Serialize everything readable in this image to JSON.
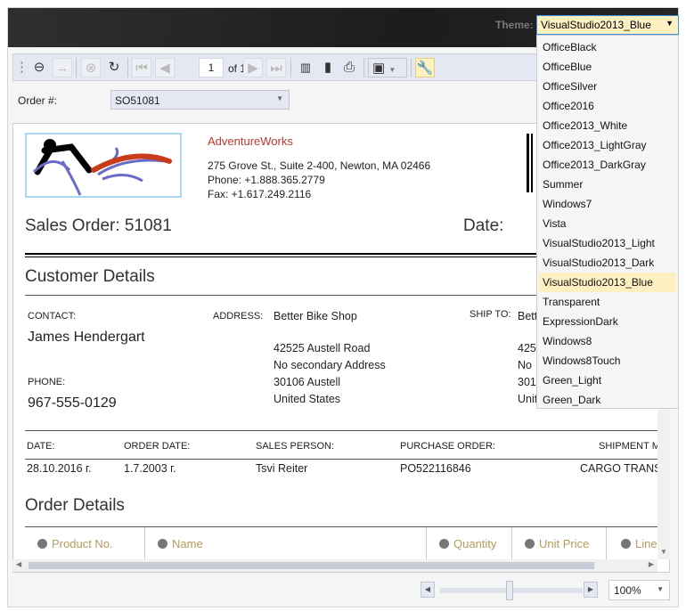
{
  "header": {
    "theme_label": "Theme:",
    "theme_value": "VisualStudio2013_Blue",
    "theme_options": [
      "OfficeBlack",
      "OfficeBlue",
      "OfficeSilver",
      "Office2016",
      "Office2013_White",
      "Office2013_LightGray",
      "Office2013_DarkGray",
      "Summer",
      "Windows7",
      "Vista",
      "VisualStudio2013_Light",
      "VisualStudio2013_Dark",
      "VisualStudio2013_Blue",
      "Transparent",
      "ExpressionDark",
      "Windows8",
      "Windows8Touch",
      "Green_Light",
      "Green_Dark"
    ]
  },
  "toolbar": {
    "page": "1",
    "page_of": "of 1"
  },
  "filter": {
    "order_label": "Order #:",
    "order_value": "SO51081"
  },
  "report": {
    "company": "AdventureWorks",
    "address": "275 Grove St., Suite 2-400, Newton, MA 02466",
    "phone": "Phone: +1.888.365.2779",
    "fax": "Fax: +1.617.249.2116",
    "title": "Sales Order: 51081",
    "date_label": "Date:",
    "customer_heading": "Customer Details",
    "contact_label": "CONTACT:",
    "contact_name": "James Hendergart",
    "phone_label": "PHONE:",
    "phone_value": "967-555-0129",
    "address_label": "ADDRESS:",
    "address_lines": [
      "Better Bike Shop",
      "42525 Austell Road",
      "No secondary Address",
      "30106 Austell",
      "United States"
    ],
    "shipto_label": "SHIP TO:",
    "shipto_lines": [
      "Bett",
      "425",
      "No",
      "301",
      "Unit"
    ],
    "details_headers": [
      "DATE:",
      "ORDER DATE:",
      "SALES PERSON:",
      "PURCHASE ORDER:",
      "SHIPMENT M"
    ],
    "details_values": [
      "28.10.2016 г.",
      "1.7.2003 г.",
      "Tsvi Reiter",
      "PO522116846",
      "CARGO TRANS"
    ],
    "order_heading": "Order Details",
    "columns": [
      "Product No.",
      "Name",
      "Quantity",
      "Unit Price",
      "Line"
    ]
  },
  "zoom": {
    "value": "100%",
    "level_percent": 100
  },
  "colors": {
    "accent": "#3d8ee0",
    "highlight": "#fdf1c2",
    "company": "#c0392b",
    "column_header": "#b59b5b"
  }
}
